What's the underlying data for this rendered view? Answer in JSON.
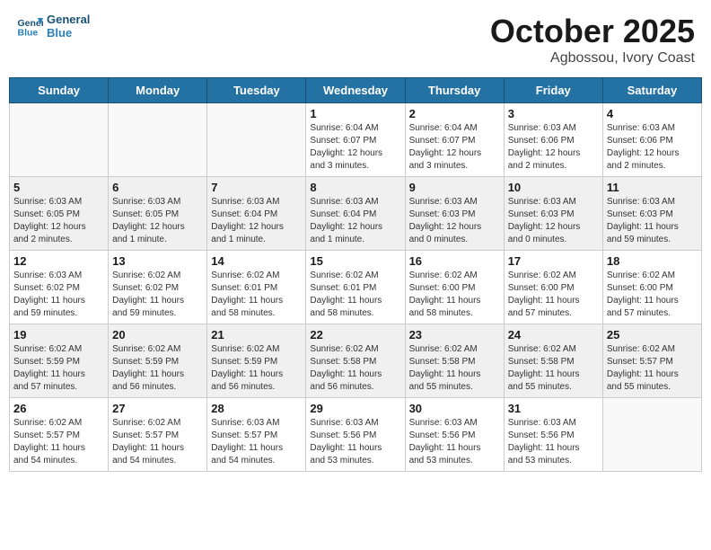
{
  "header": {
    "logo_line1": "General",
    "logo_line2": "Blue",
    "month": "October 2025",
    "location": "Agbossou, Ivory Coast"
  },
  "days_of_week": [
    "Sunday",
    "Monday",
    "Tuesday",
    "Wednesday",
    "Thursday",
    "Friday",
    "Saturday"
  ],
  "weeks": [
    [
      {
        "day": "",
        "info": ""
      },
      {
        "day": "",
        "info": ""
      },
      {
        "day": "",
        "info": ""
      },
      {
        "day": "1",
        "info": "Sunrise: 6:04 AM\nSunset: 6:07 PM\nDaylight: 12 hours\nand 3 minutes."
      },
      {
        "day": "2",
        "info": "Sunrise: 6:04 AM\nSunset: 6:07 PM\nDaylight: 12 hours\nand 3 minutes."
      },
      {
        "day": "3",
        "info": "Sunrise: 6:03 AM\nSunset: 6:06 PM\nDaylight: 12 hours\nand 2 minutes."
      },
      {
        "day": "4",
        "info": "Sunrise: 6:03 AM\nSunset: 6:06 PM\nDaylight: 12 hours\nand 2 minutes."
      }
    ],
    [
      {
        "day": "5",
        "info": "Sunrise: 6:03 AM\nSunset: 6:05 PM\nDaylight: 12 hours\nand 2 minutes."
      },
      {
        "day": "6",
        "info": "Sunrise: 6:03 AM\nSunset: 6:05 PM\nDaylight: 12 hours\nand 1 minute."
      },
      {
        "day": "7",
        "info": "Sunrise: 6:03 AM\nSunset: 6:04 PM\nDaylight: 12 hours\nand 1 minute."
      },
      {
        "day": "8",
        "info": "Sunrise: 6:03 AM\nSunset: 6:04 PM\nDaylight: 12 hours\nand 1 minute."
      },
      {
        "day": "9",
        "info": "Sunrise: 6:03 AM\nSunset: 6:03 PM\nDaylight: 12 hours\nand 0 minutes."
      },
      {
        "day": "10",
        "info": "Sunrise: 6:03 AM\nSunset: 6:03 PM\nDaylight: 12 hours\nand 0 minutes."
      },
      {
        "day": "11",
        "info": "Sunrise: 6:03 AM\nSunset: 6:03 PM\nDaylight: 11 hours\nand 59 minutes."
      }
    ],
    [
      {
        "day": "12",
        "info": "Sunrise: 6:03 AM\nSunset: 6:02 PM\nDaylight: 11 hours\nand 59 minutes."
      },
      {
        "day": "13",
        "info": "Sunrise: 6:02 AM\nSunset: 6:02 PM\nDaylight: 11 hours\nand 59 minutes."
      },
      {
        "day": "14",
        "info": "Sunrise: 6:02 AM\nSunset: 6:01 PM\nDaylight: 11 hours\nand 58 minutes."
      },
      {
        "day": "15",
        "info": "Sunrise: 6:02 AM\nSunset: 6:01 PM\nDaylight: 11 hours\nand 58 minutes."
      },
      {
        "day": "16",
        "info": "Sunrise: 6:02 AM\nSunset: 6:00 PM\nDaylight: 11 hours\nand 58 minutes."
      },
      {
        "day": "17",
        "info": "Sunrise: 6:02 AM\nSunset: 6:00 PM\nDaylight: 11 hours\nand 57 minutes."
      },
      {
        "day": "18",
        "info": "Sunrise: 6:02 AM\nSunset: 6:00 PM\nDaylight: 11 hours\nand 57 minutes."
      }
    ],
    [
      {
        "day": "19",
        "info": "Sunrise: 6:02 AM\nSunset: 5:59 PM\nDaylight: 11 hours\nand 57 minutes."
      },
      {
        "day": "20",
        "info": "Sunrise: 6:02 AM\nSunset: 5:59 PM\nDaylight: 11 hours\nand 56 minutes."
      },
      {
        "day": "21",
        "info": "Sunrise: 6:02 AM\nSunset: 5:59 PM\nDaylight: 11 hours\nand 56 minutes."
      },
      {
        "day": "22",
        "info": "Sunrise: 6:02 AM\nSunset: 5:58 PM\nDaylight: 11 hours\nand 56 minutes."
      },
      {
        "day": "23",
        "info": "Sunrise: 6:02 AM\nSunset: 5:58 PM\nDaylight: 11 hours\nand 55 minutes."
      },
      {
        "day": "24",
        "info": "Sunrise: 6:02 AM\nSunset: 5:58 PM\nDaylight: 11 hours\nand 55 minutes."
      },
      {
        "day": "25",
        "info": "Sunrise: 6:02 AM\nSunset: 5:57 PM\nDaylight: 11 hours\nand 55 minutes."
      }
    ],
    [
      {
        "day": "26",
        "info": "Sunrise: 6:02 AM\nSunset: 5:57 PM\nDaylight: 11 hours\nand 54 minutes."
      },
      {
        "day": "27",
        "info": "Sunrise: 6:02 AM\nSunset: 5:57 PM\nDaylight: 11 hours\nand 54 minutes."
      },
      {
        "day": "28",
        "info": "Sunrise: 6:03 AM\nSunset: 5:57 PM\nDaylight: 11 hours\nand 54 minutes."
      },
      {
        "day": "29",
        "info": "Sunrise: 6:03 AM\nSunset: 5:56 PM\nDaylight: 11 hours\nand 53 minutes."
      },
      {
        "day": "30",
        "info": "Sunrise: 6:03 AM\nSunset: 5:56 PM\nDaylight: 11 hours\nand 53 minutes."
      },
      {
        "day": "31",
        "info": "Sunrise: 6:03 AM\nSunset: 5:56 PM\nDaylight: 11 hours\nand 53 minutes."
      },
      {
        "day": "",
        "info": ""
      }
    ]
  ]
}
